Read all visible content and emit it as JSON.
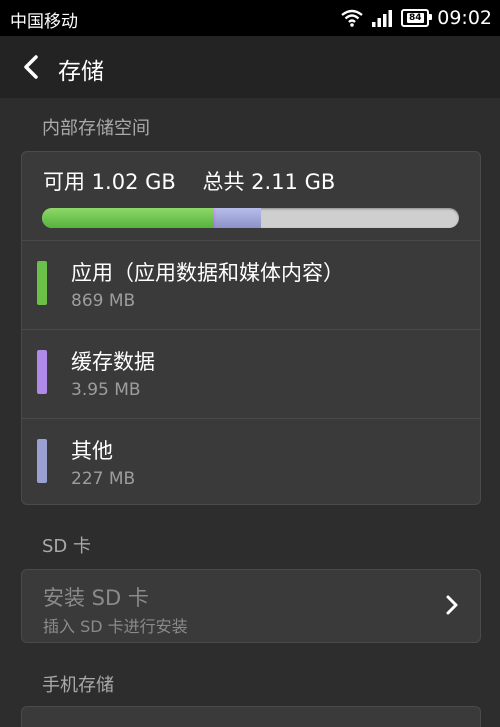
{
  "status_bar": {
    "carrier": "中国移动",
    "battery": "84",
    "time": "09:02"
  },
  "header": {
    "title": "存储"
  },
  "internal": {
    "section_label": "内部存储空间",
    "summary": "可用 1.02 GB    总共 2.11 GB",
    "usage_fraction": {
      "apps": 0.412,
      "cache": 0.002,
      "other": 0.107
    },
    "colors": {
      "apps": "#6cc04a",
      "cache": "#b08ae8",
      "other": "#9ba0d2",
      "free": "#cfcfcf"
    },
    "items": [
      {
        "title": "应用（应用数据和媒体内容）",
        "size": "869 MB"
      },
      {
        "title": "缓存数据",
        "size": "3.95 MB"
      },
      {
        "title": "其他",
        "size": "227 MB"
      }
    ]
  },
  "sd": {
    "section_label": "SD 卡",
    "install_title": "安装 SD 卡",
    "install_sub": "插入 SD 卡进行安装"
  },
  "phone": {
    "section_label": "手机存储"
  }
}
